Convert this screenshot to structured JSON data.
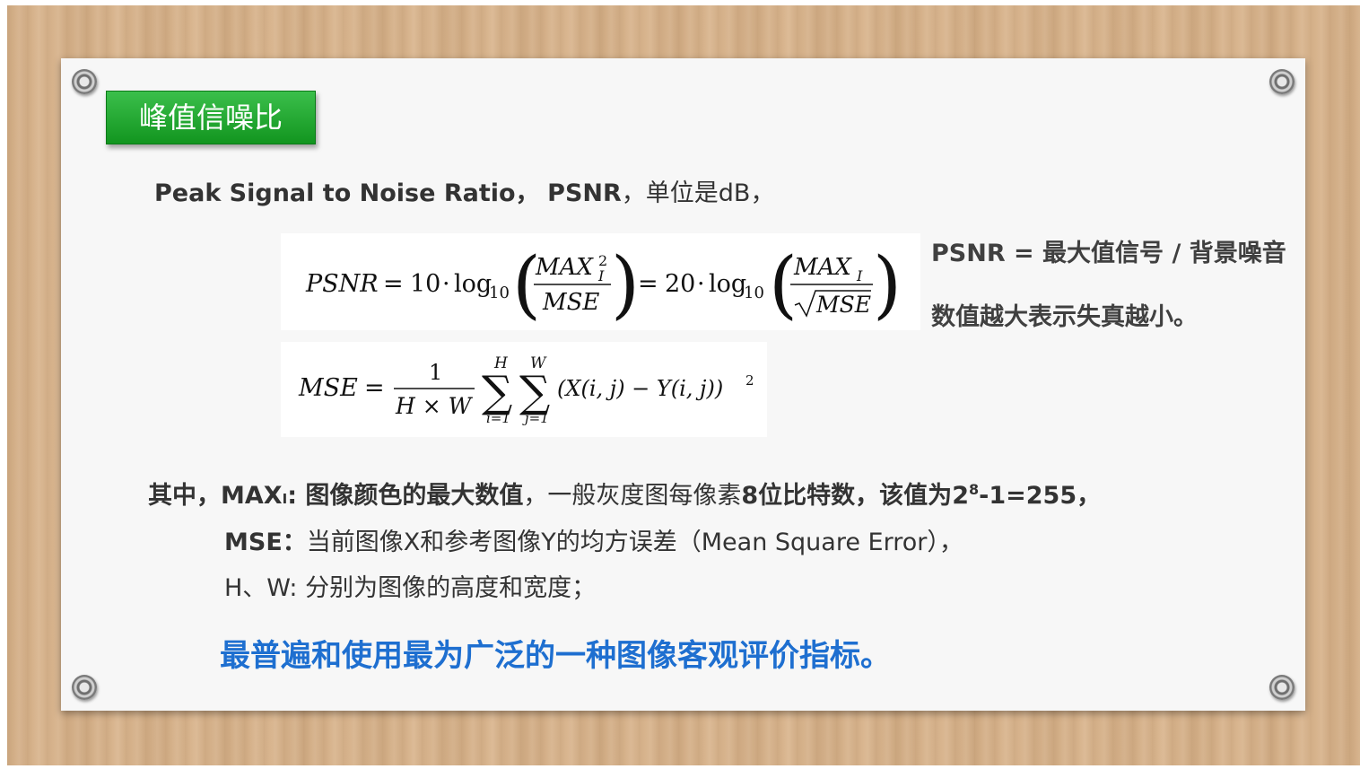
{
  "title": "峰值信噪比",
  "intro": {
    "full_name": "Peak Signal to Noise Ratio，",
    "abbr": "PSNR",
    "unit_text": "，单位是dB，"
  },
  "side_notes": {
    "line1": "PSNR = 最大值信号 / 背景噪音",
    "line2": "数值越大表示失真越小。"
  },
  "definitions": {
    "prefix": "其中，",
    "max_label": "MAX",
    "max_sub": "I",
    "max_colon": ": ",
    "max_desc_bold": "图像颜色的最大数值",
    "max_desc_mid": "，一般灰度图每像素",
    "max_bits": "8位比特数，该值为",
    "max_value_base": "2",
    "max_value_exp": "8",
    "max_value_rest": "-1=255，",
    "mse_label": "MSE：",
    "mse_desc": "当前图像X和参考图像Y的均方误差（Mean Square Error），",
    "hw_desc": "H、W: 分别为图像的高度和宽度；"
  },
  "highlight": "最普遍和使用最为广泛的一种图像客观评价指标。",
  "formula_psnr": {
    "lhs": "PSNR",
    "c1": "10",
    "c2": "20",
    "log": "log",
    "base": "10",
    "num1": "MAX",
    "sub": "I",
    "sup": "2",
    "den1": "MSE",
    "num2": "MAX",
    "den2": "MSE"
  },
  "formula_mse": {
    "lhs": "MSE",
    "num": "1",
    "den": "H × W",
    "sum1_top": "H",
    "sum1_bot": "i=1",
    "sum2_top": "W",
    "sum2_bot": "j=1",
    "body": "(X(i, j) − Y(i, j))",
    "exp": "2"
  },
  "colors": {
    "title_bg": "#1aa52a",
    "highlight": "#1e6fd0",
    "text": "#333333"
  }
}
